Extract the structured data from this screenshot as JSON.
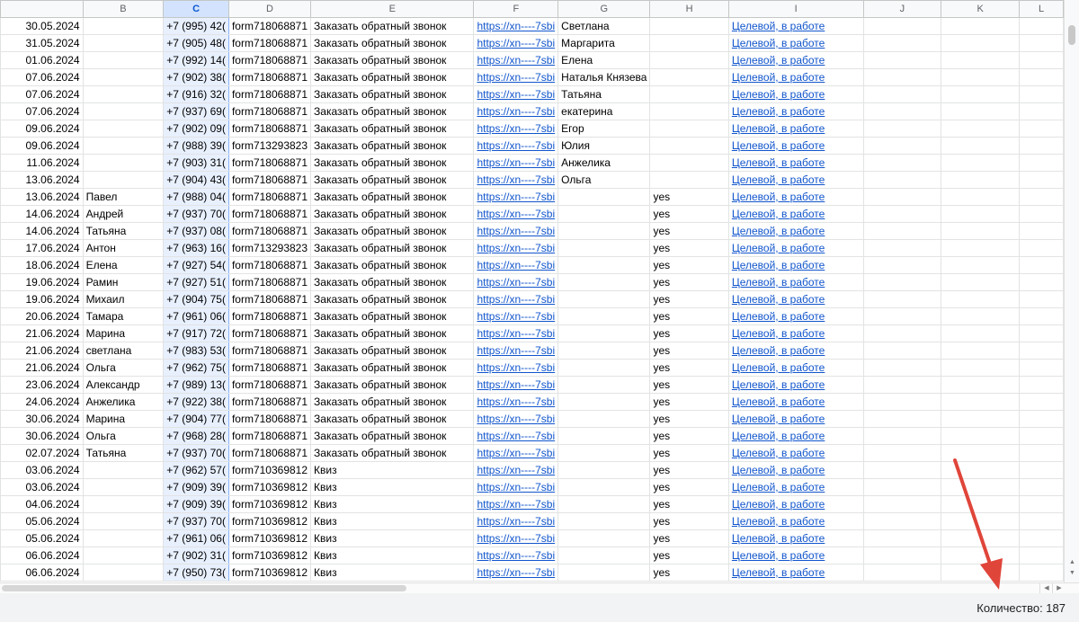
{
  "columns": [
    "",
    "B",
    "C",
    "D",
    "E",
    "F",
    "G",
    "H",
    "I",
    "J",
    "K",
    "L"
  ],
  "rows": [
    {
      "date": "30.05.2024",
      "name": "",
      "phone": "+7 (995) 42(",
      "form": "form718068871",
      "type": "Заказать обратный звонок",
      "link": "https://xn----7sbi",
      "g": "Светлана",
      "h": "",
      "status": "Целевой, в работе"
    },
    {
      "date": "31.05.2024",
      "name": "",
      "phone": "+7 (905) 48(",
      "form": "form718068871",
      "type": "Заказать обратный звонок",
      "link": "https://xn----7sbi",
      "g": "Маргарита",
      "h": "",
      "status": "Целевой, в работе"
    },
    {
      "date": "01.06.2024",
      "name": "",
      "phone": "+7 (992) 14(",
      "form": "form718068871",
      "type": "Заказать обратный звонок",
      "link": "https://xn----7sbi",
      "g": "Елена",
      "h": "",
      "status": "Целевой, в работе"
    },
    {
      "date": "07.06.2024",
      "name": "",
      "phone": "+7 (902) 38(",
      "form": "form718068871",
      "type": "Заказать обратный звонок",
      "link": "https://xn----7sbi",
      "g": "Наталья Князева",
      "h": "",
      "status": "Целевой, в работе"
    },
    {
      "date": "07.06.2024",
      "name": "",
      "phone": "+7 (916) 32(",
      "form": "form718068871",
      "type": "Заказать обратный звонок",
      "link": "https://xn----7sbi",
      "g": "Татьяна",
      "h": "",
      "status": "Целевой, в работе"
    },
    {
      "date": "07.06.2024",
      "name": "",
      "phone": "+7 (937) 69(",
      "form": "form718068871",
      "type": "Заказать обратный звонок",
      "link": "https://xn----7sbi",
      "g": "екатерина",
      "h": "",
      "status": "Целевой, в работе"
    },
    {
      "date": "09.06.2024",
      "name": "",
      "phone": "+7 (902) 09(",
      "form": "form718068871",
      "type": "Заказать обратный звонок",
      "link": "https://xn----7sbi",
      "g": "Егор",
      "h": "",
      "status": "Целевой, в работе"
    },
    {
      "date": "09.06.2024",
      "name": "",
      "phone": "+7 (988) 39(",
      "form": "form713293823",
      "type": "Заказать обратный звонок",
      "link": "https://xn----7sbi",
      "g": "Юлия",
      "h": "",
      "status": "Целевой, в работе"
    },
    {
      "date": "11.06.2024",
      "name": "",
      "phone": "+7 (903) 31(",
      "form": "form718068871",
      "type": "Заказать обратный звонок",
      "link": "https://xn----7sbi",
      "g": "Анжелика",
      "h": "",
      "status": "Целевой, в работе"
    },
    {
      "date": "13.06.2024",
      "name": "",
      "phone": "+7 (904) 43(",
      "form": "form718068871",
      "type": "Заказать обратный звонок",
      "link": "https://xn----7sbi",
      "g": "Ольга",
      "h": "",
      "status": "Целевой, в работе"
    },
    {
      "date": "13.06.2024",
      "name": "Павел",
      "phone": "+7 (988) 04(",
      "form": "form718068871",
      "type": "Заказать обратный звонок",
      "link": "https://xn----7sbi",
      "g": "",
      "h": "yes",
      "status": "Целевой, в работе"
    },
    {
      "date": "14.06.2024",
      "name": "Андрей",
      "phone": "+7 (937) 70(",
      "form": "form718068871",
      "type": "Заказать обратный звонок",
      "link": "https://xn----7sbi",
      "g": "",
      "h": "yes",
      "status": "Целевой, в работе"
    },
    {
      "date": "14.06.2024",
      "name": "Татьяна",
      "phone": "+7 (937) 08(",
      "form": "form718068871",
      "type": "Заказать обратный звонок",
      "link": "https://xn----7sbi",
      "g": "",
      "h": "yes",
      "status": "Целевой, в работе"
    },
    {
      "date": "17.06.2024",
      "name": "Антон",
      "phone": "+7 (963) 16(",
      "form": "form713293823",
      "type": "Заказать обратный звонок",
      "link": "https://xn----7sbi",
      "g": "",
      "h": "yes",
      "status": "Целевой, в работе"
    },
    {
      "date": "18.06.2024",
      "name": "Елена",
      "phone": "+7 (927) 54(",
      "form": "form718068871",
      "type": "Заказать обратный звонок",
      "link": "https://xn----7sbi",
      "g": "",
      "h": "yes",
      "status": "Целевой, в работе"
    },
    {
      "date": "19.06.2024",
      "name": "Рамин",
      "phone": "+7 (927) 51(",
      "form": "form718068871",
      "type": "Заказать обратный звонок",
      "link": "https://xn----7sbi",
      "g": "",
      "h": "yes",
      "status": "Целевой, в работе"
    },
    {
      "date": "19.06.2024",
      "name": "Михаил",
      "phone": "+7 (904) 75(",
      "form": "form718068871",
      "type": "Заказать обратный звонок",
      "link": "https://xn----7sbi",
      "g": "",
      "h": "yes",
      "status": "Целевой, в работе"
    },
    {
      "date": "20.06.2024",
      "name": "Тамара",
      "phone": "+7 (961) 06(",
      "form": "form718068871",
      "type": "Заказать обратный звонок",
      "link": "https://xn----7sbi",
      "g": "",
      "h": "yes",
      "status": "Целевой, в работе"
    },
    {
      "date": "21.06.2024",
      "name": "Марина",
      "phone": "+7 (917) 72(",
      "form": "form718068871",
      "type": "Заказать обратный звонок",
      "link": "https://xn----7sbi",
      "g": "",
      "h": "yes",
      "status": "Целевой, в работе"
    },
    {
      "date": "21.06.2024",
      "name": "светлана",
      "phone": "+7 (983) 53(",
      "form": "form718068871",
      "type": "Заказать обратный звонок",
      "link": "https://xn----7sbi",
      "g": "",
      "h": "yes",
      "status": "Целевой, в работе"
    },
    {
      "date": "21.06.2024",
      "name": "Ольга",
      "phone": "+7 (962) 75(",
      "form": "form718068871",
      "type": "Заказать обратный звонок",
      "link": "https://xn----7sbi",
      "g": "",
      "h": "yes",
      "status": "Целевой, в работе"
    },
    {
      "date": "23.06.2024",
      "name": "Александр",
      "phone": "+7 (989) 13(",
      "form": "form718068871",
      "type": "Заказать обратный звонок",
      "link": "https://xn----7sbi",
      "g": "",
      "h": "yes",
      "status": "Целевой, в работе"
    },
    {
      "date": "24.06.2024",
      "name": "Анжелика",
      "phone": "+7 (922) 38(",
      "form": "form718068871",
      "type": "Заказать обратный звонок",
      "link": "https://xn----7sbi",
      "g": "",
      "h": "yes",
      "status": "Целевой, в работе"
    },
    {
      "date": "30.06.2024",
      "name": "Марина",
      "phone": "+7 (904) 77(",
      "form": "form718068871",
      "type": "Заказать обратный звонок",
      "link": "https://xn----7sbi",
      "g": "",
      "h": "yes",
      "status": "Целевой, в работе"
    },
    {
      "date": "30.06.2024",
      "name": "Ольга",
      "phone": "+7 (968) 28(",
      "form": "form718068871",
      "type": "Заказать обратный звонок",
      "link": "https://xn----7sbi",
      "g": "",
      "h": "yes",
      "status": "Целевой, в работе"
    },
    {
      "date": "02.07.2024",
      "name": "Татьяна",
      "phone": "+7 (937) 70(",
      "form": "form718068871",
      "type": "Заказать обратный звонок",
      "link": "https://xn----7sbi",
      "g": "",
      "h": "yes",
      "status": "Целевой, в работе"
    },
    {
      "date": "03.06.2024",
      "name": "",
      "phone": "+7 (962) 57(",
      "form": "form710369812",
      "type": "Квиз",
      "link": "https://xn----7sbi",
      "g": "",
      "h": "yes",
      "status": "Целевой, в работе"
    },
    {
      "date": "03.06.2024",
      "name": "",
      "phone": "+7 (909) 39(",
      "form": "form710369812",
      "type": "Квиз",
      "link": "https://xn----7sbi",
      "g": "",
      "h": "yes",
      "status": "Целевой, в работе"
    },
    {
      "date": "04.06.2024",
      "name": "",
      "phone": "+7 (909) 39(",
      "form": "form710369812",
      "type": "Квиз",
      "link": "https://xn----7sbi",
      "g": "",
      "h": "yes",
      "status": "Целевой, в работе"
    },
    {
      "date": "05.06.2024",
      "name": "",
      "phone": "+7 (937) 70(",
      "form": "form710369812",
      "type": "Квиз",
      "link": "https://xn----7sbi",
      "g": "",
      "h": "yes",
      "status": "Целевой, в работе"
    },
    {
      "date": "05.06.2024",
      "name": "",
      "phone": "+7 (961) 06(",
      "form": "form710369812",
      "type": "Квиз",
      "link": "https://xn----7sbi",
      "g": "",
      "h": "yes",
      "status": "Целевой, в работе"
    },
    {
      "date": "06.06.2024",
      "name": "",
      "phone": "+7 (902) 31(",
      "form": "form710369812",
      "type": "Квиз",
      "link": "https://xn----7sbi",
      "g": "",
      "h": "yes",
      "status": "Целевой, в работе"
    },
    {
      "date": "06.06.2024",
      "name": "",
      "phone": "+7 (950) 73(",
      "form": "form710369812",
      "type": "Квиз",
      "link": "https://xn----7sbi",
      "g": "",
      "h": "yes",
      "status": "Целевой, в работе"
    }
  ],
  "status_bar": {
    "count_label": "Количество: 187"
  },
  "colors": {
    "link": "#1155cc",
    "selected_column": "#e8f0fe",
    "annotation_arrow": "#e0453a"
  },
  "annotation_icon": "red-arrow-pointing-to-count"
}
